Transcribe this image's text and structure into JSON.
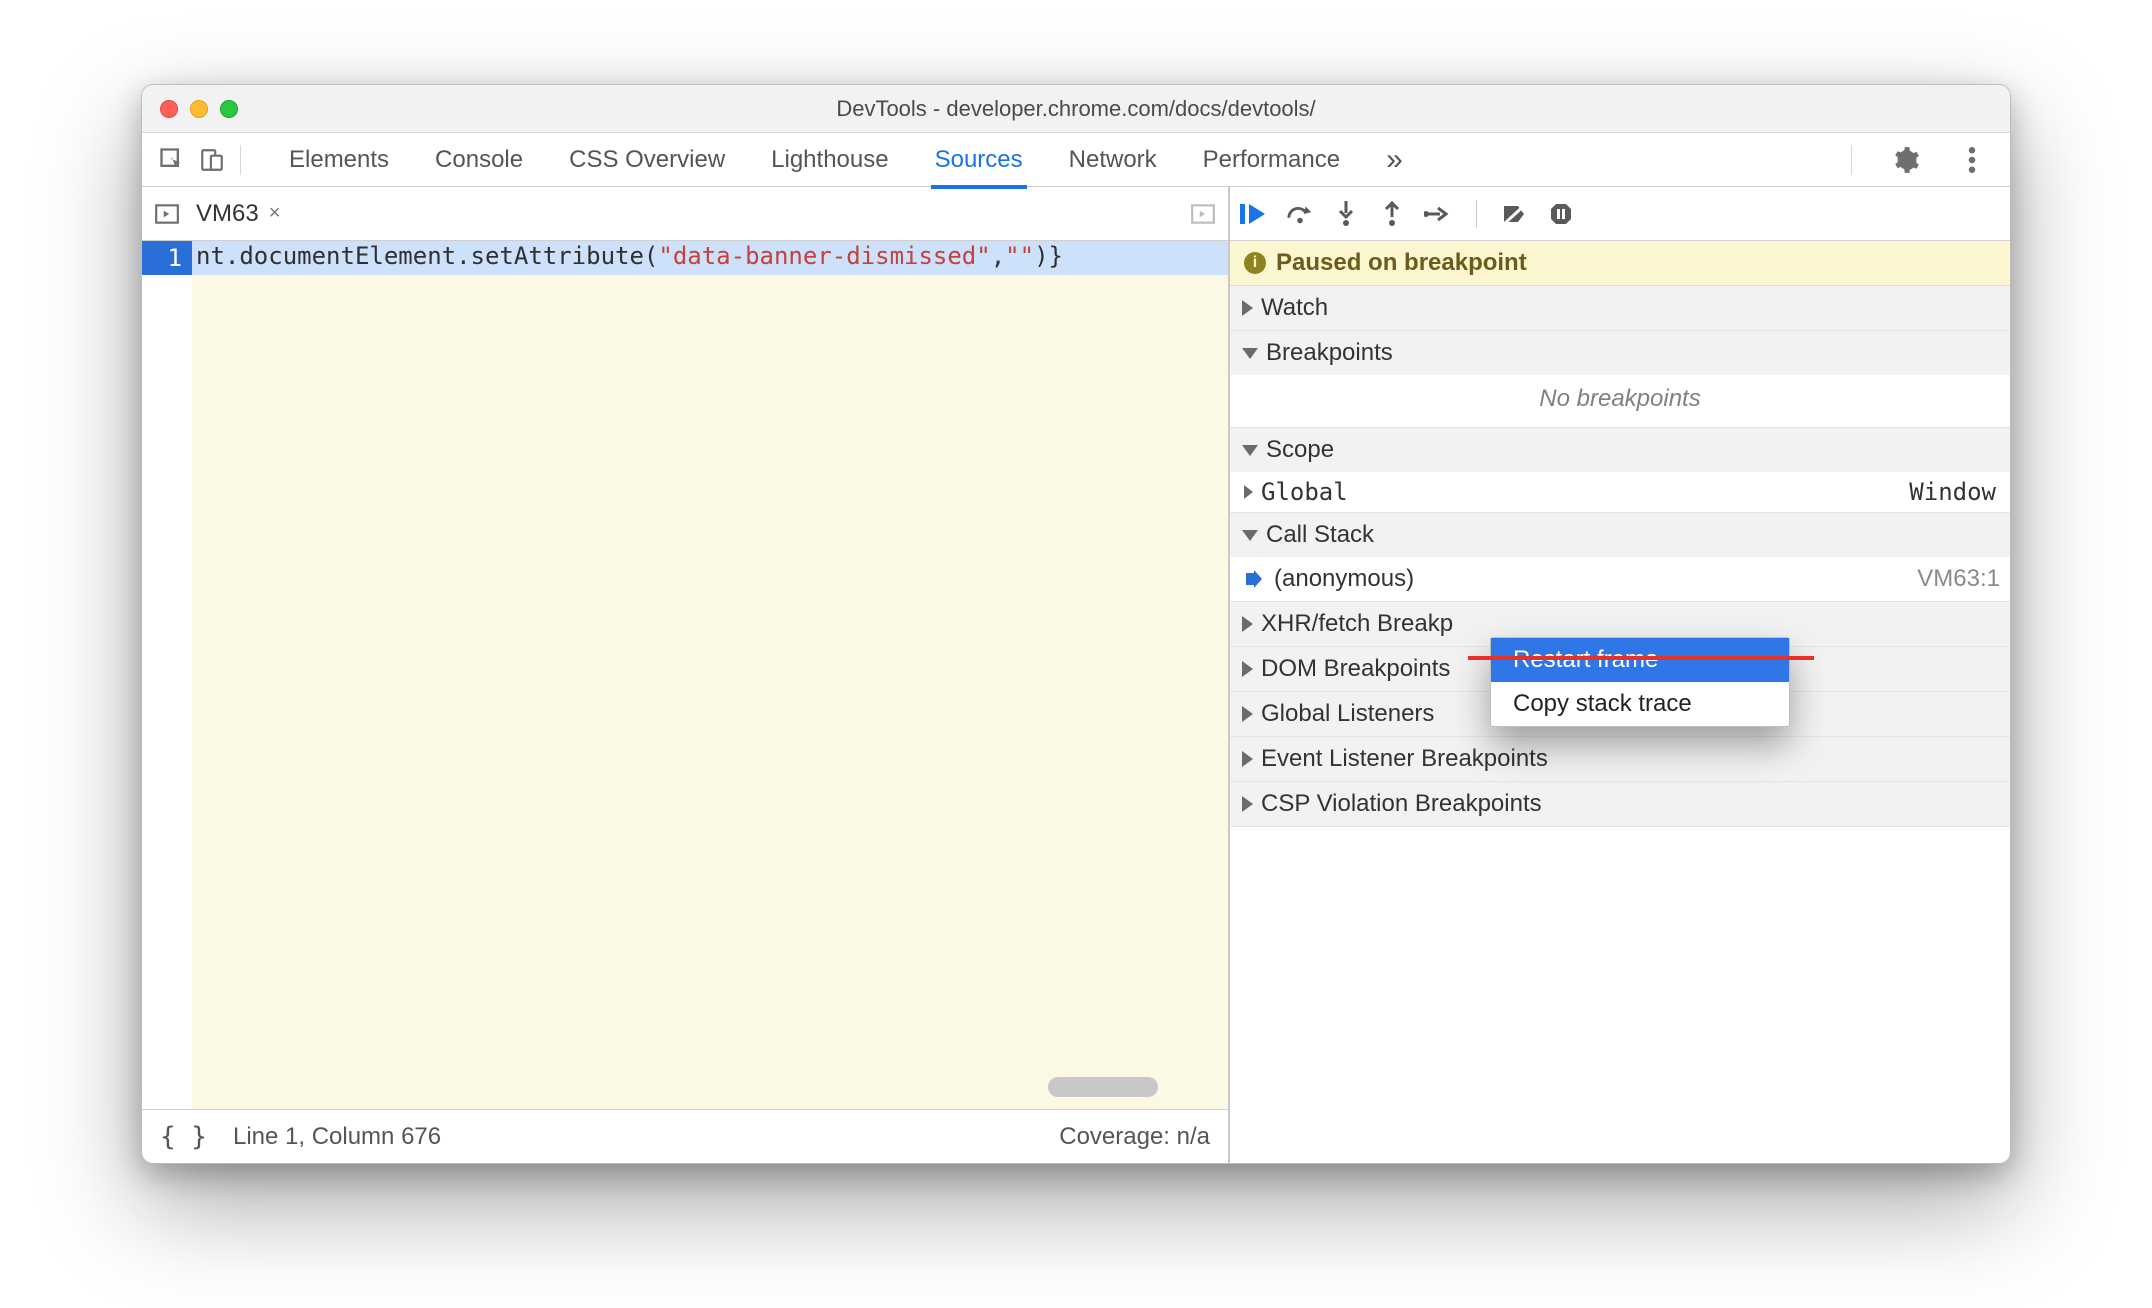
{
  "window": {
    "title": "DevTools - developer.chrome.com/docs/devtools/"
  },
  "tabs": {
    "items": [
      "Elements",
      "Console",
      "CSS Overview",
      "Lighthouse",
      "Sources",
      "Network",
      "Performance"
    ],
    "active": "Sources"
  },
  "editor": {
    "file_tab": "VM63",
    "line_number": "1",
    "code_prefix": "nt.documentElement.setAttribute(",
    "code_string": "\"data-banner-dismissed\"",
    "code_mid": ",",
    "code_string2": "\"\"",
    "code_suffix": ")}",
    "status_left": "Line 1, Column 676",
    "status_right": "Coverage: n/a"
  },
  "debugger": {
    "pause_banner": "Paused on breakpoint",
    "sections": {
      "watch": "Watch",
      "breakpoints": "Breakpoints",
      "no_breakpoints": "No breakpoints",
      "scope": "Scope",
      "scope_global": "Global",
      "scope_global_value": "Window",
      "callstack": "Call Stack",
      "callstack_frame": "(anonymous)",
      "callstack_loc": "VM63:1",
      "xhr": "XHR/fetch Breakp",
      "dom": "DOM Breakpoints",
      "global_listeners": "Global Listeners",
      "event_listener": "Event Listener Breakpoints",
      "csp": "CSP Violation Breakpoints"
    },
    "context_menu": {
      "restart_frame": "Restart frame",
      "copy_stack": "Copy stack trace"
    }
  }
}
